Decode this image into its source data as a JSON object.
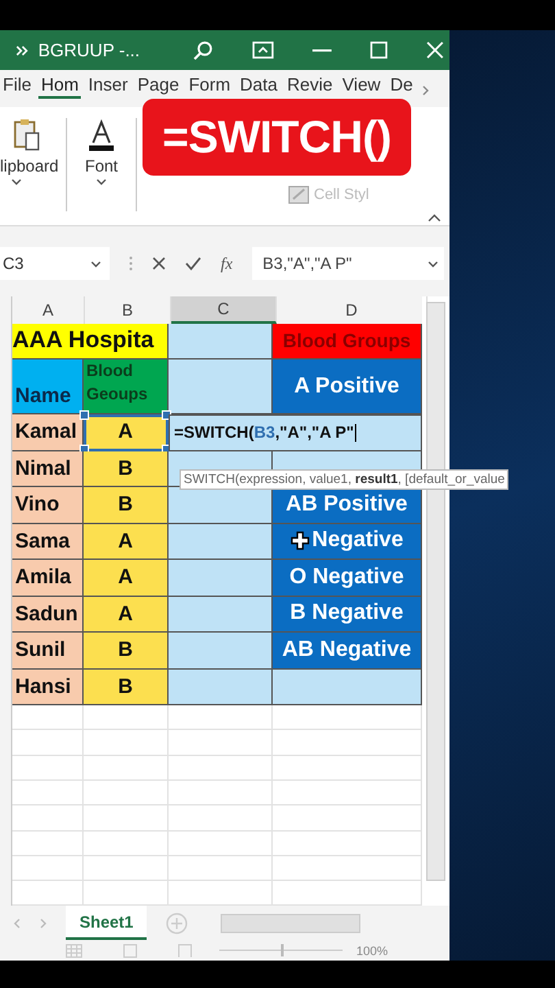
{
  "window": {
    "title": "BGRUUP  -..."
  },
  "ribbon_tabs": [
    {
      "label": "File",
      "selected": false
    },
    {
      "label": "Hom",
      "selected": true
    },
    {
      "label": "Inser",
      "selected": false
    },
    {
      "label": "Page",
      "selected": false
    },
    {
      "label": "Form",
      "selected": false
    },
    {
      "label": "Data",
      "selected": false
    },
    {
      "label": "Revie",
      "selected": false
    },
    {
      "label": "View",
      "selected": false
    },
    {
      "label": "De",
      "selected": false
    }
  ],
  "ribbon_groups": [
    {
      "label": "lipboard",
      "kind": "clipboard"
    },
    {
      "label": "Font",
      "kind": "font"
    },
    {
      "label": "Cell Styl",
      "kind": "styles"
    }
  ],
  "overlay_label": "=SWITCH()",
  "formula_bar": {
    "name_box": "C3",
    "fx": "fx",
    "value": "B3,\"A\",\"A P\""
  },
  "columns": [
    {
      "label": "A",
      "selected": false
    },
    {
      "label": "B",
      "selected": false
    },
    {
      "label": "C",
      "selected": true
    },
    {
      "label": "D",
      "selected": false
    }
  ],
  "rows": [
    {
      "kind": "title",
      "a": "AAA Hospita",
      "d": "Blood Groups"
    },
    {
      "kind": "header",
      "a": "Name",
      "b": "Blood Geoups",
      "d": "A Positive"
    },
    {
      "kind": "editing",
      "a": "Kamal",
      "b": "A",
      "formula": [
        "=SWITCH(",
        "B3",
        ",\"A\",\"A P\""
      ]
    },
    {
      "kind": "data",
      "a": "Nimal",
      "b": "B"
    },
    {
      "kind": "data",
      "a": "Vino",
      "b": "B",
      "d": "AB Positive"
    },
    {
      "kind": "data",
      "a": "Sama",
      "b": "A",
      "d": "Negative",
      "cursor": true
    },
    {
      "kind": "data",
      "a": "Amila",
      "b": "A",
      "d": "O Negative"
    },
    {
      "kind": "data",
      "a": "Sadun",
      "b": "A",
      "d": "B Negative"
    },
    {
      "kind": "data",
      "a": "Sunil",
      "b": "B",
      "d": "AB Negative"
    },
    {
      "kind": "data",
      "a": "Hansi",
      "b": "B"
    }
  ],
  "tooltip": "SWITCH(expression, value1, **result1**, [default_or_value",
  "sheet_tabs": [
    {
      "label": "Sheet1",
      "selected": true
    }
  ],
  "zoom_slider": {
    "level": 0.5
  },
  "zoom": "100%"
}
